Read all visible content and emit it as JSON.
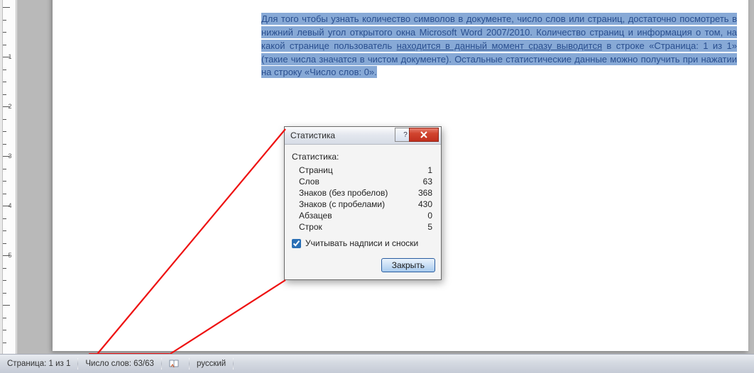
{
  "ruler": {
    "marks": [
      1,
      2,
      3,
      4,
      5
    ]
  },
  "document": {
    "paragraph": "Для того чтобы узнать количество символов в документе, число слов или страниц, достаточно посмотреть в нижний левый угол открытого окна Microsoft Word 2007/2010. Количество страниц и информация о том, на какой странице пользователь ",
    "underlined": "находится в данный момент сразу выводится",
    "paragraph_tail": " в строке «Страница: 1 из 1» (такие числа значатся в чистом документе). Остальные статистические данные можно получить при нажатии на строку «Число слов: 0»."
  },
  "dialog": {
    "title": "Статистика",
    "heading": "Статистика:",
    "rows": [
      {
        "label": "Страниц",
        "value": "1"
      },
      {
        "label": "Слов",
        "value": "63"
      },
      {
        "label": "Знаков (без пробелов)",
        "value": "368"
      },
      {
        "label": "Знаков (с пробелами)",
        "value": "430"
      },
      {
        "label": "Абзацев",
        "value": "0"
      },
      {
        "label": "Строк",
        "value": "5"
      }
    ],
    "checkbox_label": "Учитывать надписи и сноски",
    "close_button": "Закрыть"
  },
  "statusbar": {
    "page": "Страница: 1 из 1",
    "words": "Число слов: 63/63",
    "language": "русский"
  }
}
